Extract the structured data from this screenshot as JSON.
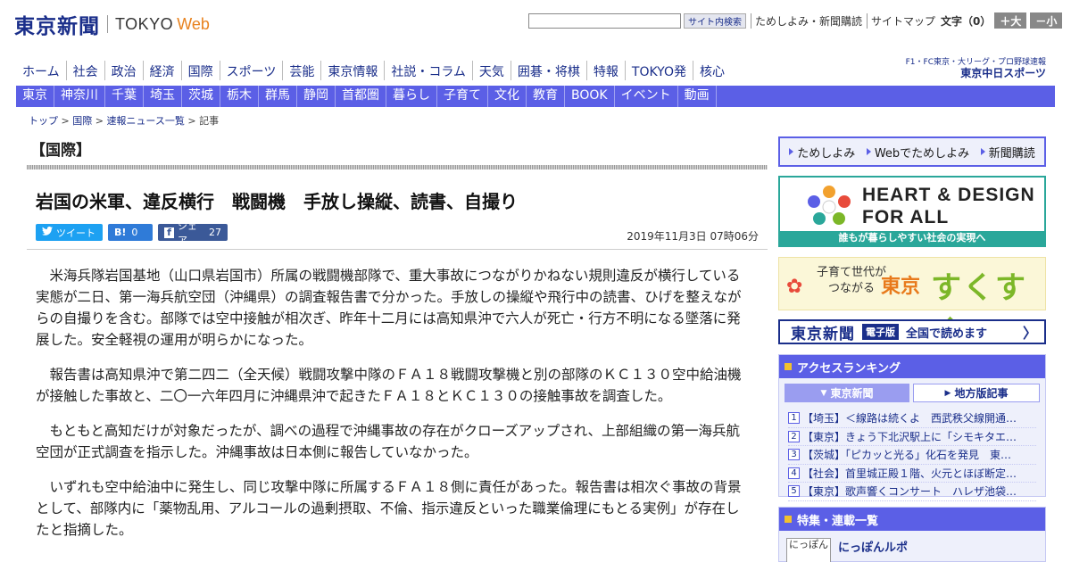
{
  "header": {
    "logo_jp": "東京新聞",
    "logo_tokyo": "TOKYO",
    "logo_web": "Web",
    "search_btn": "サイト内検索",
    "link_trial": "ためしよみ・新聞購読",
    "link_sitemap": "サイトマップ",
    "fontsize_label": "文字（0）",
    "font_plus": "＋大",
    "font_minus": "－小"
  },
  "mainnav": [
    "ホーム",
    "社会",
    "政治",
    "経済",
    "国際",
    "スポーツ",
    "芸能",
    "東京情報",
    "社説・コラム",
    "天気",
    "囲碁・将棋",
    "特報",
    "TOKYO発",
    "核心"
  ],
  "chunichi": {
    "line1": "F1・FC東京・大リーグ・プロ野球速報",
    "line2": "東京中日スポーツ"
  },
  "subnav": [
    "東京",
    "神奈川",
    "千葉",
    "埼玉",
    "茨城",
    "栃木",
    "群馬",
    "静岡",
    "首都圏",
    "暮らし",
    "子育て",
    "文化",
    "教育",
    "BOOK",
    "イベント",
    "動画"
  ],
  "breadcrumb": {
    "top": "トップ",
    "section": "国際",
    "list": "速報ニュース一覧",
    "current": "記事",
    "sep": " > "
  },
  "article": {
    "category": "【国際】",
    "headline": "岩国の米軍、違反横行　戦闘機　手放し操縦、読書、自撮り",
    "tweet": "ツイート",
    "hatena_label": "B!",
    "hatena_count": "0",
    "share_label": "シェア",
    "share_count": "27",
    "date": "2019年11月3日 07時06分",
    "paragraphs": [
      "米海兵隊岩国基地（山口県岩国市）所属の戦闘機部隊で、重大事故につながりかねない規則違反が横行している実態が二日、第一海兵航空団（沖縄県）の調査報告書で分かった。手放しの操縦や飛行中の読書、ひげを整えながらの自撮りを含む。部隊では空中接触が相次ぎ、昨年十二月には高知県沖で六人が死亡・行方不明になる墜落に発展した。安全軽視の運用が明らかになった。",
      "報告書は高知県沖で第二四二（全天候）戦闘攻撃中隊のＦＡ１８戦闘攻撃機と別の部隊のＫＣ１３０空中給油機が接触した事故と、二〇一六年四月に沖縄県沖で起きたＦＡ１８とＫＣ１３０の接触事故を調査した。",
      "もともと高知だけが対象だったが、調べの過程で沖縄事故の存在がクローズアップされ、上部組織の第一海兵航空団が正式調査を指示した。沖縄事故は日本側に報告していなかった。",
      "いずれも空中給油中に発生し、同じ攻撃中隊に所属するＦＡ１８側に責任があった。報告書は相次ぐ事故の背景として、部隊内に「薬物乱用、アルコールの過剰摂取、不倫、指示違反といった職業倫理にもとる実例」が存在したと指摘した。"
    ]
  },
  "sidebar": {
    "trial": [
      "ためしよみ",
      "Webでためしよみ",
      "新聞購読"
    ],
    "hdfa": {
      "line1": "HEART & DESIGN",
      "line2": "FOR ALL",
      "tagline": "誰もが暮らしやすい社会の実現へ"
    },
    "suku": {
      "small1": "子育て世代が",
      "small2": "つながる",
      "tokyo": "東京",
      "big": "すくすく"
    },
    "eshimbun": {
      "logo": "東京新聞",
      "badge": "電子版",
      "text": "全国で読めます"
    },
    "ranking": {
      "title": "アクセスランキング",
      "tab_active": "東京新聞",
      "tab_inactive": "地方版記事",
      "items": [
        {
          "num": "1",
          "text": "【埼玉】＜線路は続くよ　西武秩父線開通…"
        },
        {
          "num": "2",
          "text": "【東京】きょう下北沢駅上に「シモキタエ…"
        },
        {
          "num": "3",
          "text": "【茨城】「ピカッと光る」化石を発見　東…"
        },
        {
          "num": "4",
          "text": "【社会】首里城正殿１階、火元とほぼ断定…"
        },
        {
          "num": "5",
          "text": "【東京】歌声響くコンサート　ハレザ池袋…"
        }
      ]
    },
    "feature": {
      "title": "特集・連載一覧",
      "thumb": "にっぽん",
      "item": "にっぽんルポ"
    }
  },
  "colors": {
    "brand": "#1a2e8a",
    "nav_bar": "#5b5fe6",
    "accent_orange": "#e8821e",
    "hdfa_teal": "#2aa79a"
  }
}
